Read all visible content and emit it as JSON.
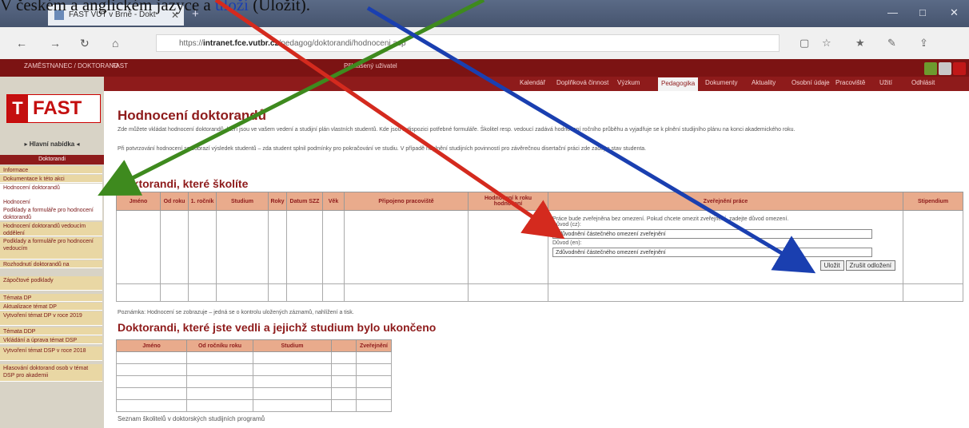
{
  "caption": {
    "prefix": "V českém a anglickém jazyce a",
    "red": "",
    "link": "uloží",
    "suffix": "(Uložit)."
  },
  "browser": {
    "tab_title": "FAST VUT v Brně - Dokt",
    "url_prefix": "https://",
    "url_domain": "intranet.fce.vutbr.cz",
    "url_rest": "/pedagog/doktorandi/hodnoceni.asp"
  },
  "site": {
    "user": "ZAMĚSTNANEC / DOKTORAND",
    "org": "FAST",
    "info": "Přihlášený uživatel"
  },
  "menu": [
    "Kalendář",
    "Doplňková činnost",
    "Výzkum",
    "Pedagogika",
    "Dokumenty",
    "Aktuality",
    "Osobní údaje",
    "Pracoviště",
    "Užití",
    "Odhlásit"
  ],
  "menu_active_index": 3,
  "logo": {
    "letter": "T",
    "text": "FAST"
  },
  "sidebar": {
    "main_menu": "▸ Hlavní nabídka ◂",
    "header": "Doktorandi",
    "items": [
      "Informace",
      "Dokumentace k této akci",
      "Hodnocení doktorandů",
      "Hodnocení",
      "Podklady a formuláře pro hodnocení doktorandů",
      "Hodnocení doktorandů vedoucím oddělení",
      "Podklady a formuláře pro hodnocení vedoucím",
      "Rozhodnutí doktorandů na",
      "Zápočtové podklady",
      "Témata DP",
      "Aktualizace témat DP",
      "Vytvoření témat DP v roce 2019",
      "Témata DDP",
      "Vkládání a úprava témat DSP",
      "Vytvoření témat DSP v roce 2018",
      "Hlasování doktorand osob v témat DSP pro akademii"
    ]
  },
  "main": {
    "title": "Hodnocení doktorandů",
    "para1": "Zde můžete vkládat hodnocení doktorandů, kteří jsou ve vašem vedení a studijní plán vlastních studentů. Kde jsou k dispozici potřebné formuláře. Školitel resp. vedoucí zadává hodnocení ročního průběhu a vyjadřuje se k plnění studijního plánu na konci akademického roku.",
    "para2": "Při potvrzování hodnocení se zobrazí výsledek studentů – zda student splnil podmínky pro pokračování ve studiu. V případě neplnění studijních povinností pro závěrečnou disertační práci zde zadejte stav studenta.",
    "sec1": "Doktorandi, které školíte",
    "cols": [
      "Jméno",
      "Od roku",
      "1. ročník",
      "Studium",
      "Roky",
      "Datum SZZ",
      "Věk",
      "Připojeno pracoviště",
      "Hodnocení k roku hodnocení",
      "Zveřejnění práce",
      "Stipendium"
    ],
    "form_label": "Práce bude zveřejněna bez omezení. Pokud chcete omezit zveřejnění, zadejte důvod omezení.",
    "field1_label": "Důvod (cz):",
    "field1_value": "Zdůvodnění částečného omezení zveřejnění",
    "field2_label": "Důvod (en):",
    "field2_value": "Zdůvodnění částečného omezení zveřejnění",
    "save": "Uložit",
    "cancel": "Zrušit odložení",
    "note": "Poznámka: Hodnocení se zobrazuje – jedná se o kontrolu uložených záznamů, nahlížení a tisk.",
    "sec2": "Doktorandi, které jste vedli a jejichž studium bylo ukončeno",
    "cols2": [
      "Jméno",
      "Od ročníku roku",
      "Studium",
      "",
      "Zveřejnění"
    ],
    "footer": "Seznam školitelů v doktorských studijních programů"
  },
  "colors": {
    "dark_red": "#8e1b1b",
    "arrow_red": "#d42a1e",
    "arrow_green": "#3e8a1e",
    "arrow_blue": "#1a3fb0"
  }
}
